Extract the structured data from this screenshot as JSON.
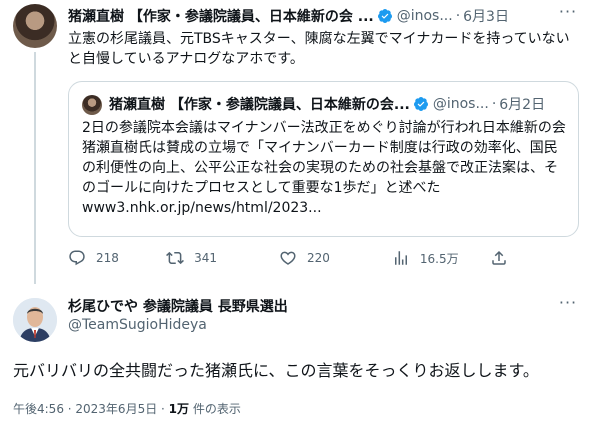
{
  "colors": {
    "verified": "#1d9bf0",
    "secondary_text": "#536471",
    "border": "#cfd9de"
  },
  "tweet1": {
    "author_name": "猪瀬直樹 【作家・参議院議員、日本維新の会 ...",
    "handle": "@inos...",
    "separator": "·",
    "date": "6月3日",
    "text": "立憲の杉尾議員、元TBSキャスター、陳腐な左翼でマイナカードを持っていないと自慢しているアナログなアホです。",
    "more_label": "···",
    "quote": {
      "author_name": "猪瀬直樹 【作家・参議院議員、日本維新の会...",
      "handle": "@inos...",
      "separator": "·",
      "date": "6月2日",
      "text": "2日の参議院本会議はマイナンバー法改正をめぐり討論が行われ日本維新の会猪瀬直樹氏は賛成の立場で「マイナンバーカード制度は行政の効率化、国民の利便性の向上、公平公正な社会の実現のための社会基盤で改正法案は、そのゴールに向けたプロセスとして重要な1歩だ」と述べた www3.nhk.or.jp/news/html/2023..."
    },
    "actions": {
      "reply_icon": "reply-icon",
      "reply_count": "218",
      "retweet_icon": "retweet-icon",
      "retweet_count": "341",
      "like_icon": "heart-icon",
      "like_count": "220",
      "views_icon": "bar-chart-icon",
      "views_count": "16.5万",
      "share_icon": "share-icon"
    }
  },
  "tweet2": {
    "author_name": "杉尾ひでや 参議院議員 長野県選出",
    "handle": "@TeamSugioHideya",
    "more_label": "···",
    "text": "元バリバリの全共闘だった猪瀬氏に、この言葉をそっくりお返しします。",
    "timestamp": "午後4:56 · 2023年6月5日 · ",
    "views_count": "1万",
    "views_label": " 件の表示"
  }
}
